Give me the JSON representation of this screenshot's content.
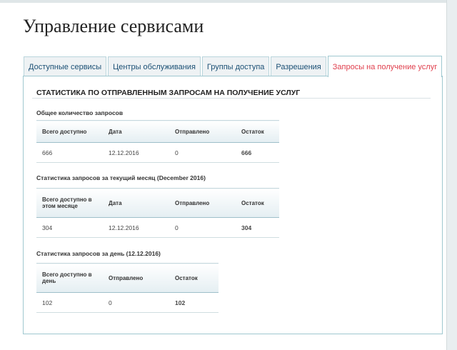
{
  "page": {
    "title": "Управление сервисами"
  },
  "tabs": [
    {
      "label": "Доступные сервисы",
      "active": false
    },
    {
      "label": "Центры обслуживания",
      "active": false
    },
    {
      "label": "Группы доступа",
      "active": false
    },
    {
      "label": "Разрешения",
      "active": false
    },
    {
      "label": "Запросы на получение услуг",
      "active": true
    }
  ],
  "panel": {
    "title": "СТАТИСТИКА ПО ОТПРАВЛЕННЫМ ЗАПРОСАМ НА ПОЛУЧЕНИЕ УСЛУГ"
  },
  "sections": {
    "total": {
      "title": "Общее количество запросов",
      "headers": [
        "Всего доступно",
        "Дата",
        "Отправлено",
        "Остаток"
      ],
      "row": [
        "666",
        "12.12.2016",
        "0",
        "666"
      ]
    },
    "month": {
      "title": "Статистика запросов за текущий месяц (December 2016)",
      "headers": [
        "Всего доступно в этом месяце",
        "Дата",
        "Отправлено",
        "Остаток"
      ],
      "row": [
        "304",
        "12.12.2016",
        "0",
        "304"
      ]
    },
    "day": {
      "title": "Статистика запросов за день (12.12.2016)",
      "headers": [
        "Всего доступно в день",
        "Отправлено",
        "Остаток"
      ],
      "row": [
        "102",
        "0",
        "102"
      ]
    }
  },
  "colors": {
    "active_tab": "#e0404e",
    "tab_text": "#1a4f74",
    "border": "#9fc8d0"
  }
}
